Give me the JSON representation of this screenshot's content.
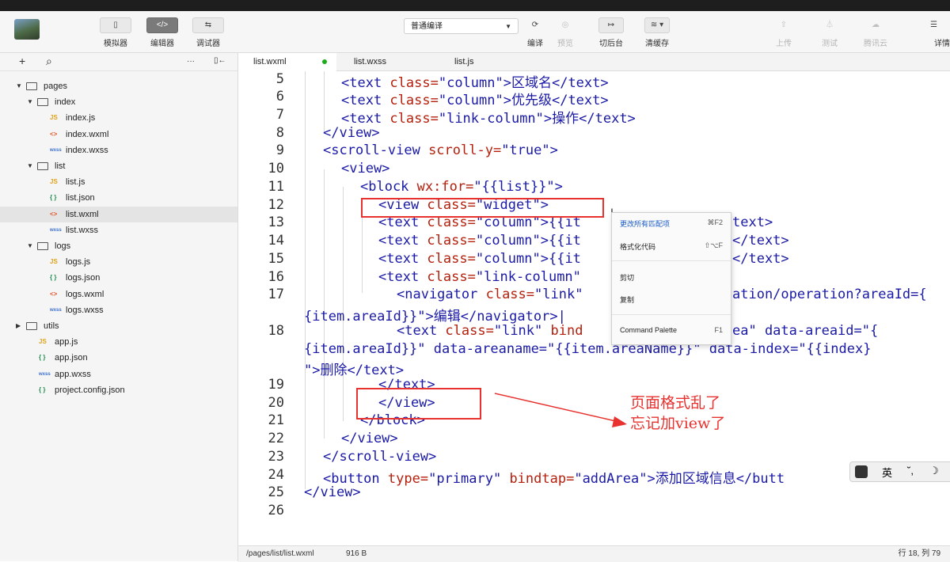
{
  "toolbar": {
    "simulator": "模拟器",
    "editor": "编辑器",
    "debugger": "调试器",
    "compile_mode": "普通编译",
    "compile": "编译",
    "preview": "预览",
    "background": "切后台",
    "clear_cache": "清缓存",
    "upload": "上传",
    "test": "测试",
    "tencent_cloud": "腾讯云",
    "details": "详情"
  },
  "sidebar": {
    "add": "+",
    "search": "⌕",
    "more": "···",
    "collapse": "▯←",
    "tree": [
      {
        "label": "pages",
        "type": "folder"
      },
      {
        "label": "index",
        "type": "folder"
      },
      {
        "label": "index.js",
        "type": "js"
      },
      {
        "label": "index.wxml",
        "type": "wxml"
      },
      {
        "label": "index.wxss",
        "type": "wxss"
      },
      {
        "label": "list",
        "type": "folder"
      },
      {
        "label": "list.js",
        "type": "js"
      },
      {
        "label": "list.json",
        "type": "json"
      },
      {
        "label": "list.wxml",
        "type": "wxml"
      },
      {
        "label": "list.wxss",
        "type": "wxss"
      },
      {
        "label": "logs",
        "type": "folder"
      },
      {
        "label": "logs.js",
        "type": "js"
      },
      {
        "label": "logs.json",
        "type": "json"
      },
      {
        "label": "logs.wxml",
        "type": "wxml"
      },
      {
        "label": "logs.wxss",
        "type": "wxss"
      },
      {
        "label": "utils",
        "type": "folder"
      },
      {
        "label": "app.js",
        "type": "js"
      },
      {
        "label": "app.json",
        "type": "json"
      },
      {
        "label": "app.wxss",
        "type": "wxss"
      },
      {
        "label": "project.config.json",
        "type": "json"
      }
    ]
  },
  "tabs": [
    "list.wxml",
    "list.wxss",
    "list.js"
  ],
  "editor": {
    "line_numbers": [
      "5",
      "6",
      "7",
      "8",
      "9",
      "10",
      "11",
      "12",
      "13",
      "14",
      "15",
      "16",
      "17",
      "18",
      "19",
      "20",
      "21",
      "22",
      "23",
      "24",
      "25",
      "26"
    ],
    "code": {
      "l5": {
        "a": "<text ",
        "b": "class=",
        "c": "\"column\"",
        "d": ">区域名</text>"
      },
      "l6": {
        "a": "<text ",
        "b": "class=",
        "c": "\"column\"",
        "d": ">优先级</text>"
      },
      "l7": {
        "a": "<text ",
        "b": "class=",
        "c": "\"link-column\"",
        "d": ">操作</text>"
      },
      "l8": {
        "a": "</view>"
      },
      "l9": {
        "a": "<scroll-view ",
        "b": "scroll-y=",
        "c": "\"true\"",
        "d": ">"
      },
      "l10": {
        "a": "<view>"
      },
      "l11": {
        "a": "<block ",
        "b": "wx:for=",
        "c": "\"{{list}}\"",
        "d": ">"
      },
      "l12": {
        "a": "<view ",
        "b": "class=",
        "c": "\"widget\"",
        "d": ">"
      },
      "l13": {
        "a": "<text ",
        "b": "class=",
        "c": "\"column\"",
        "d": ">{{it",
        "e": "text>"
      },
      "l14": {
        "a": "<text ",
        "b": "class=",
        "c": "\"column\"",
        "d": ">{{it",
        "e": "</text>"
      },
      "l15": {
        "a": "<text ",
        "b": "class=",
        "c": "\"column\"",
        "d": ">{{it",
        "e": "</text>"
      },
      "l16": {
        "a": "<text ",
        "b": "class=",
        "c": "\"link-column\""
      },
      "l17": {
        "a": "<navigator ",
        "b": "class=",
        "c": "\"link\"",
        "e": "ation/operation?areaId={",
        "f": "{item.areaId}}\">编辑</navigator>|"
      },
      "l18": {
        "a": "<text ",
        "b": "class=",
        "c": "\"link\"",
        "d": " bind",
        "e": "ea\" data-areaid=\"{",
        "f": "{item.areaId}}\" data-areaname=\"{{item.areaName}}\" data-index=\"{{index}",
        "g": "\">删除</text>"
      },
      "l19": {
        "a": "</text>"
      },
      "l20": {
        "a": "</view>"
      },
      "l21": {
        "a": "</block>"
      },
      "l22": {
        "a": "</view>"
      },
      "l23": {
        "a": "</scroll-view>"
      },
      "l24": {
        "a": "<button ",
        "b": "type=",
        "c": "\"primary\"",
        "d": " bindtap=",
        "e": "\"addArea\"",
        "f": ">添加区域信息</butt"
      },
      "l25": {
        "a": "</view>"
      }
    }
  },
  "context_menu": {
    "items": [
      {
        "label": "更改所有匹配项",
        "shortcut": "⌘F2"
      },
      {
        "label": "格式化代码",
        "shortcut": "⇧⌥F"
      },
      {
        "label": "剪切",
        "shortcut": ""
      },
      {
        "label": "复制",
        "shortcut": ""
      },
      {
        "label": "Command Palette",
        "shortcut": "F1"
      }
    ]
  },
  "annotation": {
    "line1": "页面格式乱了",
    "line2": "忘记加view了"
  },
  "ime": {
    "lang": "英",
    "punct": "˘,",
    "moon": "☽"
  },
  "status": {
    "path": "/pages/list/list.wxml",
    "size": "916 B",
    "position": "行 18, 列 79"
  },
  "colors": {
    "annotation_red": "#e8322f",
    "tag_blue": "#1a1aa6",
    "attr_red": "#b5200d",
    "modified_dot": "#1aad19"
  }
}
